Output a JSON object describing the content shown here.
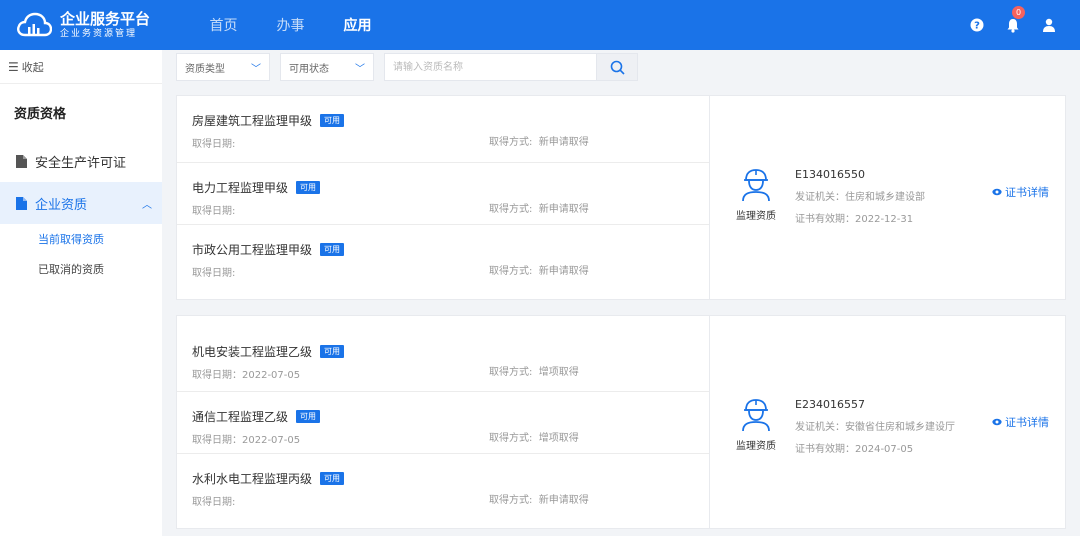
{
  "header": {
    "title": "企业服务平台",
    "subtitle": "企业务资源管理",
    "nav": [
      "首页",
      "办事",
      "应用"
    ],
    "notification_count": "0"
  },
  "sidebar": {
    "collapse_label": "收起",
    "section_title": "资质资格",
    "items": [
      {
        "label": "安全生产许可证"
      },
      {
        "label": "企业资质"
      }
    ],
    "subitems": [
      {
        "label": "当前取得资质"
      },
      {
        "label": "已取消的资质"
      }
    ]
  },
  "filters": {
    "type_select": "资质类型",
    "status_select": "可用状态",
    "search_placeholder": "请输入资质名称"
  },
  "groups": [
    {
      "rows": [
        {
          "name": "房屋建筑工程监理甲级",
          "tag": "可用",
          "date_label": "取得日期:",
          "method_label": "取得方式:",
          "method": "新申请取得"
        },
        {
          "name": "电力工程监理甲级",
          "tag": "可用",
          "date_label": "取得日期:",
          "method_label": "取得方式:",
          "method": "新申请取得"
        },
        {
          "name": "市政公用工程监理甲级",
          "tag": "可用",
          "date_label": "取得日期:",
          "method_label": "取得方式:",
          "method": "新申请取得"
        }
      ],
      "cert": {
        "icon_label": "监理资质",
        "number": "E134016550",
        "issuer": "发证机关：住房和城乡建设部",
        "valid": "证书有效期：2022-12-31",
        "link": "证书详情"
      }
    },
    {
      "rows": [
        {
          "name": "机电安装工程监理乙级",
          "tag": "可用",
          "date_label": "取得日期：2022-07-05",
          "method_label": "取得方式:",
          "method": "增项取得"
        },
        {
          "name": "通信工程监理乙级",
          "tag": "可用",
          "date_label": "取得日期：2022-07-05",
          "method_label": "取得方式:",
          "method": "增项取得"
        },
        {
          "name": "水利水电工程监理丙级",
          "tag": "可用",
          "date_label": "取得日期:",
          "method_label": "取得方式:",
          "method": "新申请取得"
        }
      ],
      "cert": {
        "icon_label": "监理资质",
        "number": "E234016557",
        "issuer": "发证机关：安徽省住房和城乡建设厅",
        "valid": "证书有效期：2024-07-05",
        "link": "证书详情"
      }
    }
  ],
  "colors": {
    "primary": "#1a73e8",
    "badge": "#f5625d"
  }
}
